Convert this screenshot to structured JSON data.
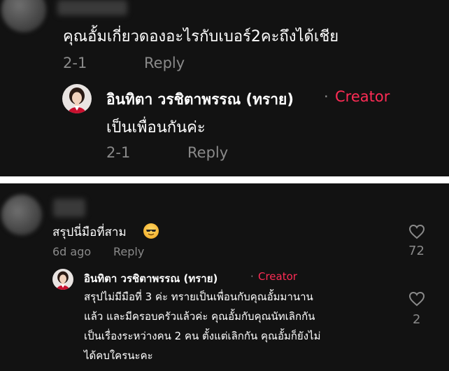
{
  "top_panel": {
    "comment": {
      "text": "คุณอั้มเกี่ยวดองอะไรกับเบอร์2คะถึงได้เชีย",
      "date": "2-1",
      "reply_label": "Reply"
    },
    "reply": {
      "author": "อินทิตา วรชิตาพรรณ (ทราย)",
      "separator": "·",
      "badge": "Creator",
      "text": "เป็นเพื่อนกันค่ะ",
      "date": "2-1",
      "reply_label": "Reply"
    }
  },
  "bottom_panel": {
    "comment": {
      "text": "สรุปนี่มือที่สาม",
      "emoji": "smiling-face-with-sunglasses-icon",
      "date": "6d ago",
      "reply_label": "Reply",
      "likes": "72"
    },
    "reply": {
      "author": "อินทิตา วรชิตาพรรณ (ทราย)",
      "separator": "·",
      "badge": "Creator",
      "lines": [
        "สรุปไม่มีมือที่ 3 ค่ะ ทรายเป็นเพื่อนกับคุณอั้มมานาน",
        "แล้ว และมีครอบครัวแล้วค่ะ คุณอั้มกับคุณนัทเลิกกัน",
        "เป็นเรื่องระหว่างคน 2 คน ตั้งแต่เลิกกัน คุณอั้มก็ยังไม่",
        "ได้คบใครนะคะ"
      ],
      "likes": "2"
    }
  },
  "colors": {
    "background": "#121212",
    "creator_accent": "#fe2c55",
    "meta_text": "#8a8a8a"
  }
}
